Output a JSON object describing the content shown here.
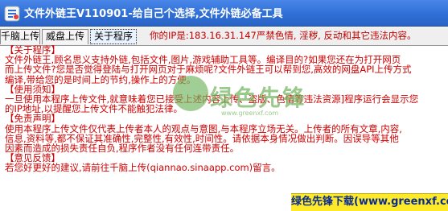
{
  "window": {
    "title": "文件外链王V110901-给自己个选择,文件外链必备工具",
    "title_bar_color": "#2f6fd6"
  },
  "tabs": [
    {
      "label": "千脑上传",
      "active": false
    },
    {
      "label": "威盘上传",
      "active": false
    },
    {
      "label": "关于程序",
      "active": true
    }
  ],
  "ip_notice": "你的IP是:183.16.31.147严禁色情,  淫秽,  反动和其它违法内容。",
  "about": {
    "lines": [
      "【关于程序】",
      "文件外链王,顾名思义支持外链,包括文件,图片,游戏辅助工具等。编译目的?如果您还在为打开网页",
      "而上传文件?您是否觉得登陆与打开网页对于麻烦呢?文件外链王可以帮到您,高效的网盘API上传方式",
      "编译,带给您的是时间上的节约,操作上的方便。",
      "【使用须知】",
      "一旦使用本程序上传文件,就意味着您已接受上述内容上传、盗版、色情等违法资源]程序运行会显示您",
      "的IP地址,以提醒您上传文件不能触犯法律。",
      "【免责声明】",
      "使用本程序上传文件仅代表上传者本人的观点与意图,与本程序立场无关。上传者的所有文章,内容,",
      "信息,资料等,都不保证其准确性,完整性,有效性,时间性。请依据本身情况做出判断。因误导等其他",
      "因素而造成的损失责任自负,程序作者没有任何连带责任。",
      "【意见反馈】",
      "若您好更好的建议,请前往千脑上传(qiannao.sinaapp.com)留言。"
    ]
  },
  "watermark": {
    "text": "绿色先锋",
    "site": "www.greenxf.com",
    "color": "#6eb45a"
  },
  "badge": {
    "text": "绿色先锋下载(www.greenxf.com)"
  }
}
